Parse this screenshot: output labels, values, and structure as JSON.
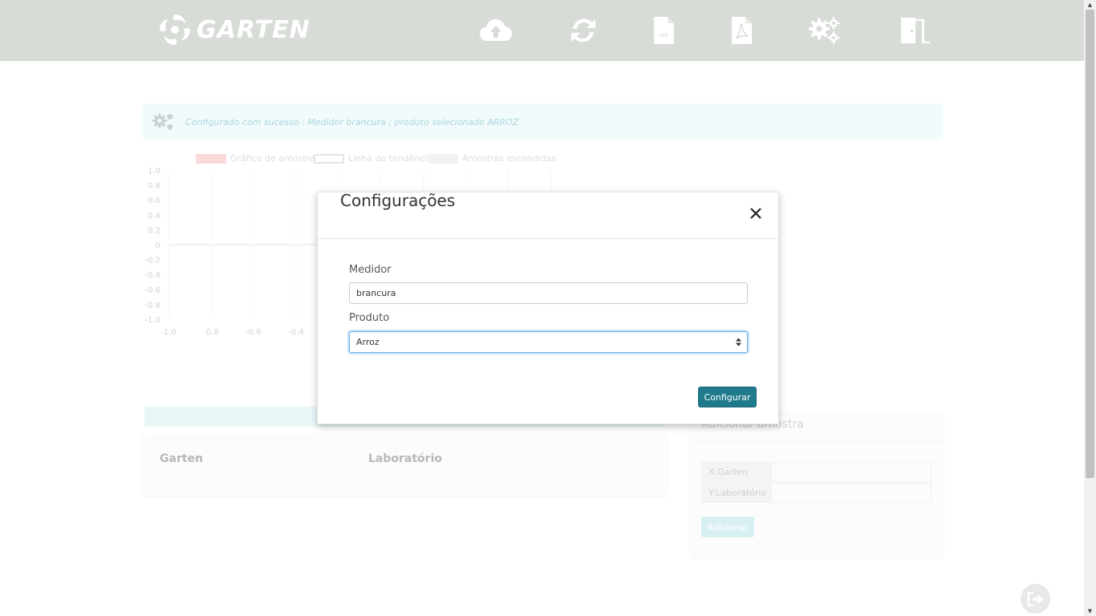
{
  "header": {
    "brand": "GARTEN",
    "icons": [
      "cloud-upload-icon",
      "refresh-icon",
      "csv-file-icon",
      "pdf-file-icon",
      "settings-icon",
      "exit-door-icon"
    ],
    "csv_label": "csv"
  },
  "alert": {
    "message": "Configurado com sucesso : Medidor brancura ; produto selecionado ARROZ"
  },
  "chart_data": {
    "type": "scatter",
    "legend": [
      "Gráfico de amostras",
      "Linha de tendência",
      "Amostras escondidas"
    ],
    "legend_colors": [
      "#f8d7d7",
      "#ffffff",
      "#efefef"
    ],
    "y_ticks": [
      "1.0",
      "0.8",
      "0.6",
      "0.4",
      "0.2",
      "0",
      "-0.2",
      "-0.4",
      "-0.6",
      "-0.8",
      "-1.0"
    ],
    "x_ticks": [
      "-1.0",
      "-0.8",
      "-0.6",
      "-0.4"
    ],
    "ylim": [
      -1.0,
      1.0
    ],
    "xlim": [
      -1.0,
      1.0
    ],
    "series": []
  },
  "table": {
    "columns": [
      "Garten",
      "Laboratório"
    ]
  },
  "add_sample": {
    "title": "Adicionar amostra",
    "x_label": "X:Garten",
    "y_label": "Y:Laboratório",
    "button": "Adicionar"
  },
  "modal": {
    "title": "Configurações",
    "medidor_label": "Medidor",
    "medidor_value": "brancura",
    "produto_label": "Produto",
    "produto_value": "Arroz",
    "submit": "Configurar"
  },
  "colors": {
    "primary_button": "#1f7a8c",
    "navbar": "#d8dcd7"
  }
}
